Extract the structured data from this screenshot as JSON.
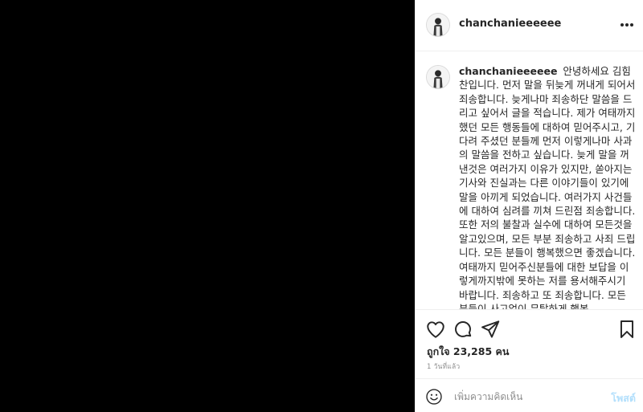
{
  "post": {
    "username": "chanchanieeeeee"
  },
  "caption": {
    "username": "chanchanieeeeee",
    "text": "안녕하세요 김힘찬입니다. 먼저 말을 뒤늦게 꺼내게 되어서 죄송합니다. 늦게나마 죄송하단 말씀을 드리고 싶어서 글을 적습니다. 제가 여태까지 했던 모든 행동들에 대하여 믿어주시고, 기다려 주셨던 분들께 먼저 이렇게나마 사과의 말씀을 전하고 싶습니다. 늦게 말을 꺼낸것은 여러가지 이유가 있지만, 쏟아지는 기사와 진실과는 다른 이야기들이 있기에 말을 아끼게 되었습니다. 여러가지 사건들에 대하여 심려를 끼쳐 드린점 죄송합니다. 또한 저의 불찰과 실수에 대하여 모든것을 알고있으며, 모든 부분 죄송하고 사죄 드립니다. 모든 분들이 행복했으면 좋겠습니다. 여태까지 믿어주신분들에 대한 보답을 이렇게까지밖에 못하는 저를 용서해주시기 바랍니다. 죄송하고 또 죄송합니다. 모든 분들이 사고없이 무탈하게 행복"
  },
  "stats": {
    "likes": "ถูกใจ 23,285 คน",
    "time": "1 วันที่แล้ว"
  },
  "comment_box": {
    "placeholder": "เพิ่มความคิดเห็น",
    "post_label": "โพสต์"
  },
  "icons": {
    "more": "more-options-icon",
    "like": "heart-icon",
    "comment": "comment-bubble-icon",
    "share": "paper-plane-icon",
    "save": "bookmark-icon",
    "emoji": "smiley-icon"
  },
  "colors": {
    "text": "#262626",
    "muted": "#8e8e8e",
    "border": "#efefef",
    "post_button_disabled": "#b2dffc"
  }
}
